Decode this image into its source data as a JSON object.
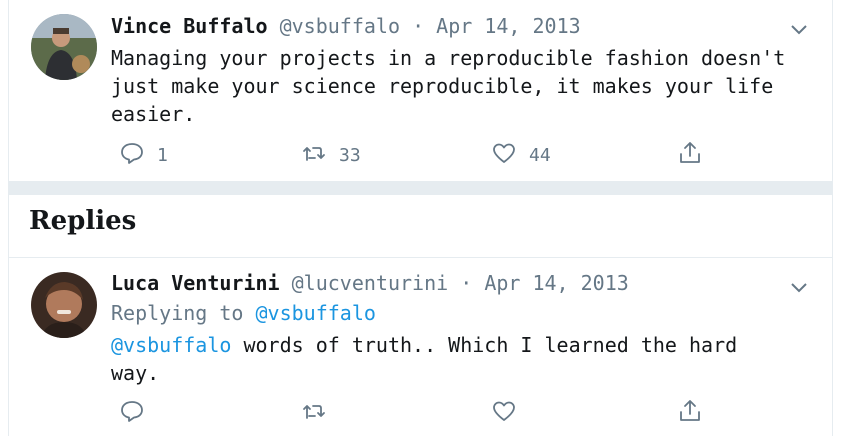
{
  "main_tweet": {
    "name": "Vince Buffalo",
    "handle": "@vsbuffalo",
    "dot": "·",
    "date": "Apr 14, 2013",
    "text": "Managing your projects in a reproducible fashion doesn't\njust make your science reproducible, it makes your life\neasier.",
    "replies": "1",
    "retweets": "33",
    "likes": "44",
    "icons": [
      "reply-icon",
      "retweet-icon",
      "like-icon",
      "share-icon",
      "chevron-down-icon"
    ]
  },
  "replies_heading": "Replies",
  "reply": {
    "name": "Luca Venturini",
    "handle": "@lucventurini",
    "dot": "·",
    "date": "Apr 14, 2013",
    "replying_prefix": "Replying to ",
    "replying_to": "@vsbuffalo",
    "mention": "@vsbuffalo",
    "text": " words of truth.. Which I learned the hard\nway."
  },
  "colors": {
    "accent": "#1b95e0",
    "muted": "#657786",
    "divider": "#e6ecf0"
  }
}
